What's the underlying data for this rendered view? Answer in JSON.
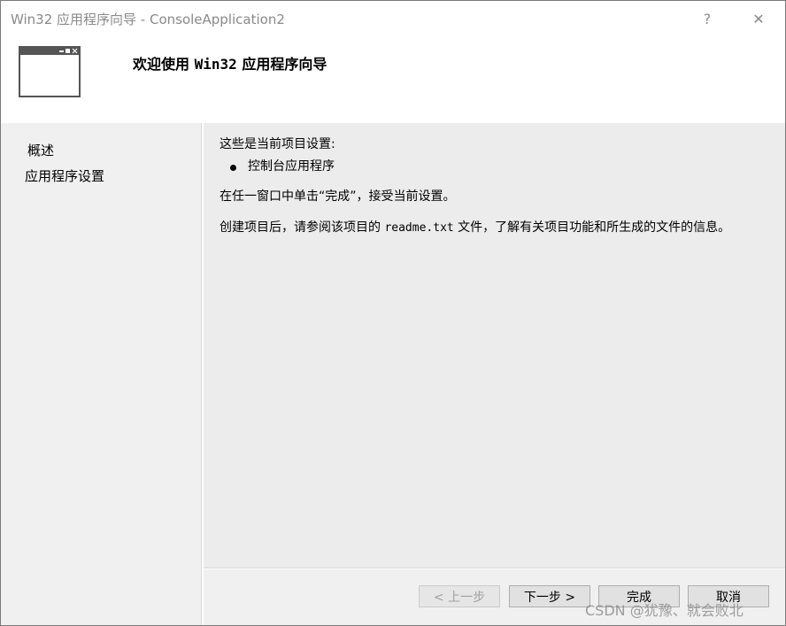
{
  "window": {
    "title": "Win32 应用程序向导 - ConsoleApplication2",
    "help_glyph": "?",
    "close_glyph": "✕"
  },
  "header": {
    "title_prefix": "欢迎使用 ",
    "title_mono": "Win32",
    "title_suffix": " 应用程序向导",
    "icon": "window-icon"
  },
  "nav": {
    "items": [
      {
        "label": "概述"
      },
      {
        "label": "应用程序设置"
      }
    ]
  },
  "content": {
    "line1": "这些是当前项目设置:",
    "bullet": "控制台应用程序",
    "line3": "在任一窗口中单击“完成”，接受当前设置。",
    "line4_prefix": "创建项目后，请参阅该项目的 ",
    "line4_mono": "readme.txt",
    "line4_suffix": " 文件，了解有关项目功能和所生成的文件的信息。"
  },
  "footer": {
    "prev_label": "< 上一步",
    "next_label": "下一步 >",
    "finish_label": "完成",
    "cancel_label": "取消"
  },
  "watermark": "CSDN @犹豫、就会败北",
  "colors": {
    "body_bg": "#f0f0f0",
    "content_bg": "#ececec",
    "title_text": "#8a8a8a"
  }
}
